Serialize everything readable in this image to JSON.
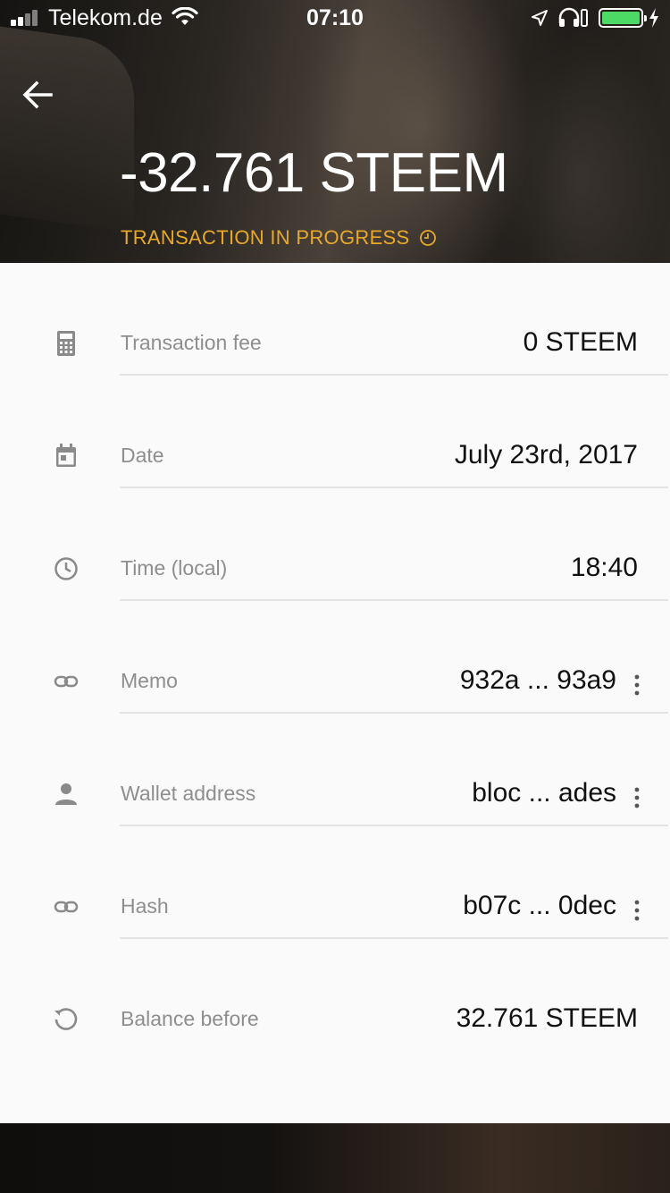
{
  "status_bar": {
    "carrier": "Telekom.de",
    "time": "07:10",
    "battery_color": "#4cd964"
  },
  "header": {
    "amount": "-32.761 STEEM",
    "status": "TRANSACTION IN PROGRESS",
    "status_color": "#e8a92a",
    "back_icon": "arrow-back-icon"
  },
  "details": [
    {
      "icon": "calculator-icon",
      "label": "Transaction fee",
      "value": "0 STEEM"
    },
    {
      "icon": "calendar-icon",
      "label": "Date",
      "value": "July 23rd, 2017"
    },
    {
      "icon": "clock-icon",
      "label": "Time (local)",
      "value": "18:40"
    },
    {
      "icon": "link-icon",
      "label": "Memo",
      "value": "932a ... 93a9"
    },
    {
      "icon": "person-icon",
      "label": "Wallet address",
      "value": "bloc ... ades"
    },
    {
      "icon": "link-icon",
      "label": "Hash",
      "value": "b07c ... 0dec"
    },
    {
      "icon": "history-icon",
      "label": "Balance before",
      "value": "32.761 STEEM"
    }
  ]
}
